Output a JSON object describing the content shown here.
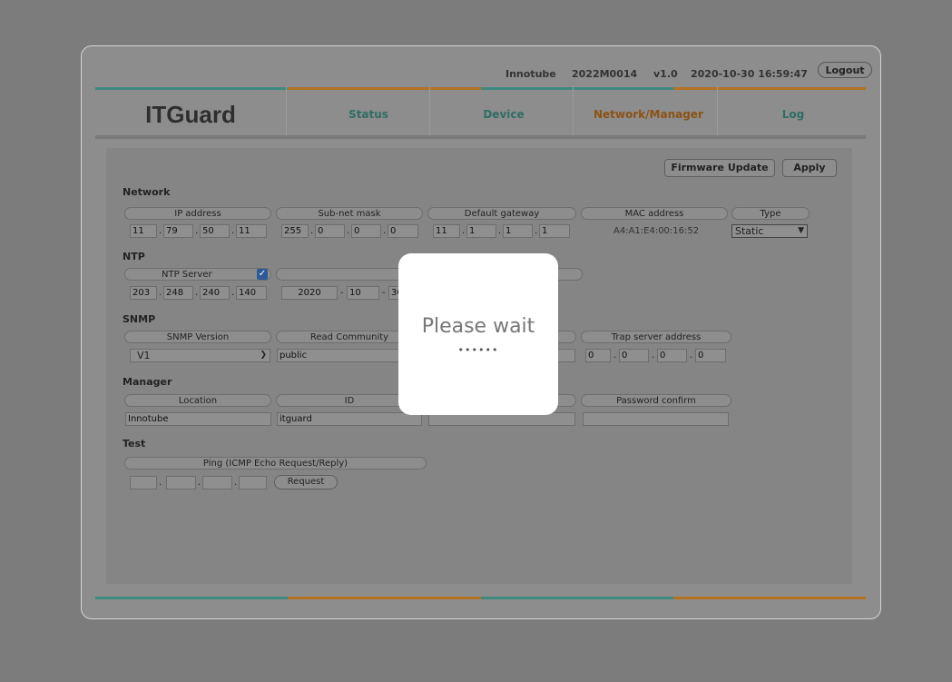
{
  "header": {
    "company": "Innotube",
    "serial": "2022M0014",
    "version": "v1.0",
    "datetime": "2020-10-30 16:59:47",
    "logout_label": "Logout"
  },
  "logo": "ITGuard",
  "tabs": [
    {
      "label": "Status"
    },
    {
      "label": "Device"
    },
    {
      "label": "Network/Manager"
    },
    {
      "label": "Log"
    }
  ],
  "actions": {
    "firmware_label": "Firmware Update",
    "apply_label": "Apply"
  },
  "network": {
    "title": "Network",
    "headers": {
      "ip": "IP address",
      "subnet": "Sub-net mask",
      "gateway": "Default gateway",
      "mac": "MAC address",
      "type": "Type"
    },
    "ip": [
      "11",
      "79",
      "50",
      "11"
    ],
    "subnet": [
      "255",
      "0",
      "0",
      "0"
    ],
    "gateway": [
      "11",
      "1",
      "1",
      "1"
    ],
    "mac": "A4:A1:E4:00:16:52",
    "type": "Static"
  },
  "ntp": {
    "title": "NTP",
    "header": "NTP Server",
    "server": [
      "203",
      "248",
      "240",
      "140"
    ],
    "date": [
      "2020",
      "10",
      "30"
    ]
  },
  "snmp": {
    "title": "SNMP",
    "headers": {
      "version": "SNMP Version",
      "read": "Read Community",
      "trap": "Trap server address"
    },
    "version": "V1",
    "read": "public",
    "trap": [
      "0",
      "0",
      "0",
      "0"
    ]
  },
  "manager": {
    "title": "Manager",
    "headers": {
      "location": "Location",
      "id": "ID",
      "password_confirm": "Password confirm"
    },
    "location": "Innotube",
    "id": "itguard",
    "password": "",
    "password_confirm": ""
  },
  "test": {
    "title": "Test",
    "header": "Ping (ICMP Echo Request/Reply)",
    "request_label": "Request"
  },
  "modal": {
    "title": "Please wait",
    "dots": "••••••"
  },
  "colors": {
    "teal": "#3e8a80",
    "orange": "#b47323",
    "checkbox": "#2c5a99"
  }
}
